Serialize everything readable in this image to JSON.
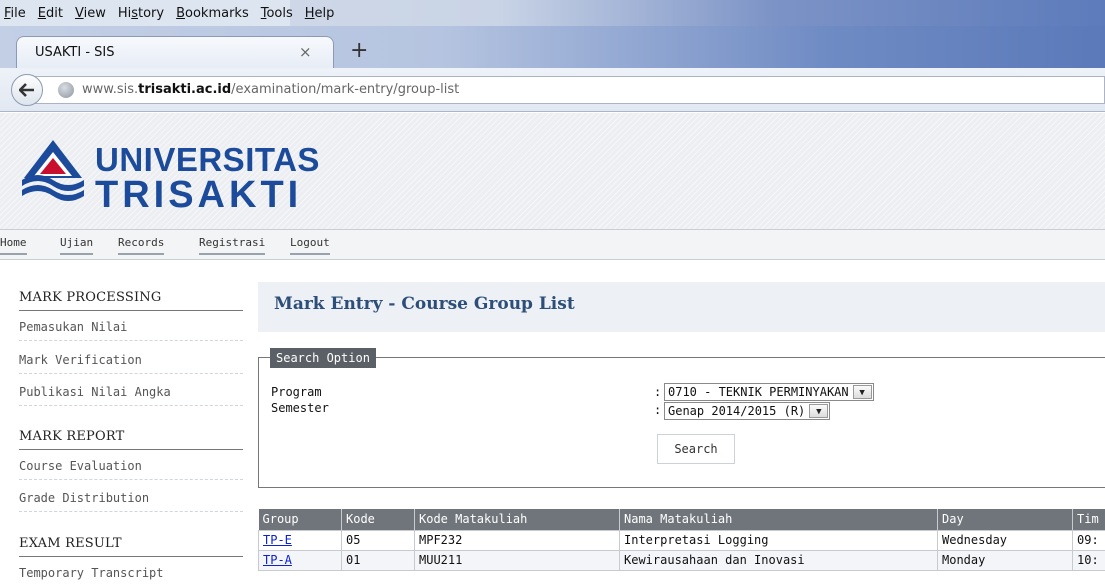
{
  "browser": {
    "menu": [
      "File",
      "Edit",
      "View",
      "History",
      "Bookmarks",
      "Tools",
      "Help"
    ],
    "menu_access_keys": [
      "F",
      "E",
      "V",
      "s",
      "B",
      "T",
      "H"
    ],
    "tab_title": "USAKTI - SIS",
    "tab_close": "×",
    "new_tab": "+",
    "url_prefix": "www.sis.",
    "url_domain": "trisakti.ac.id",
    "url_path": "/examination/mark-entry/group-list"
  },
  "site": {
    "logo_line1": "UNIVERSITAS",
    "logo_line2": "TRISAKTI",
    "brand_color": "#1b4b9a",
    "nav": [
      "Home",
      "Ujian",
      "Records",
      "Registrasi",
      "Logout"
    ]
  },
  "sidebar": {
    "sections": [
      {
        "heading": "MARK PROCESSING",
        "items": [
          "Pemasukan Nilai",
          "Mark Verification",
          "Publikasi Nilai Angka"
        ]
      },
      {
        "heading": "MARK REPORT",
        "items": [
          "Course Evaluation",
          "Grade Distribution"
        ]
      },
      {
        "heading": "EXAM RESULT",
        "items": [
          "Temporary Transcript"
        ]
      }
    ]
  },
  "main": {
    "title": "Mark Entry - Course Group List",
    "search_option": {
      "legend": "Search Option",
      "program_label": "Program",
      "program_value": "0710 - TEKNIK PERMINYAKAN",
      "semester_label": "Semester",
      "semester_value": "Genap 2014/2015 (R)",
      "colon": ":",
      "search_button": "Search"
    },
    "table": {
      "headers": [
        "Group",
        "Kode",
        "Kode Matakuliah",
        "Nama Matakuliah",
        "Day",
        "Tim"
      ],
      "rows": [
        [
          "TP-E",
          "05",
          "MPF232",
          "Interpretasi Logging",
          "Wednesday",
          "09:"
        ],
        [
          "TP-A",
          "01",
          "MUU211",
          "Kewirausahaan dan Inovasi",
          "Monday",
          "10:"
        ]
      ]
    }
  }
}
